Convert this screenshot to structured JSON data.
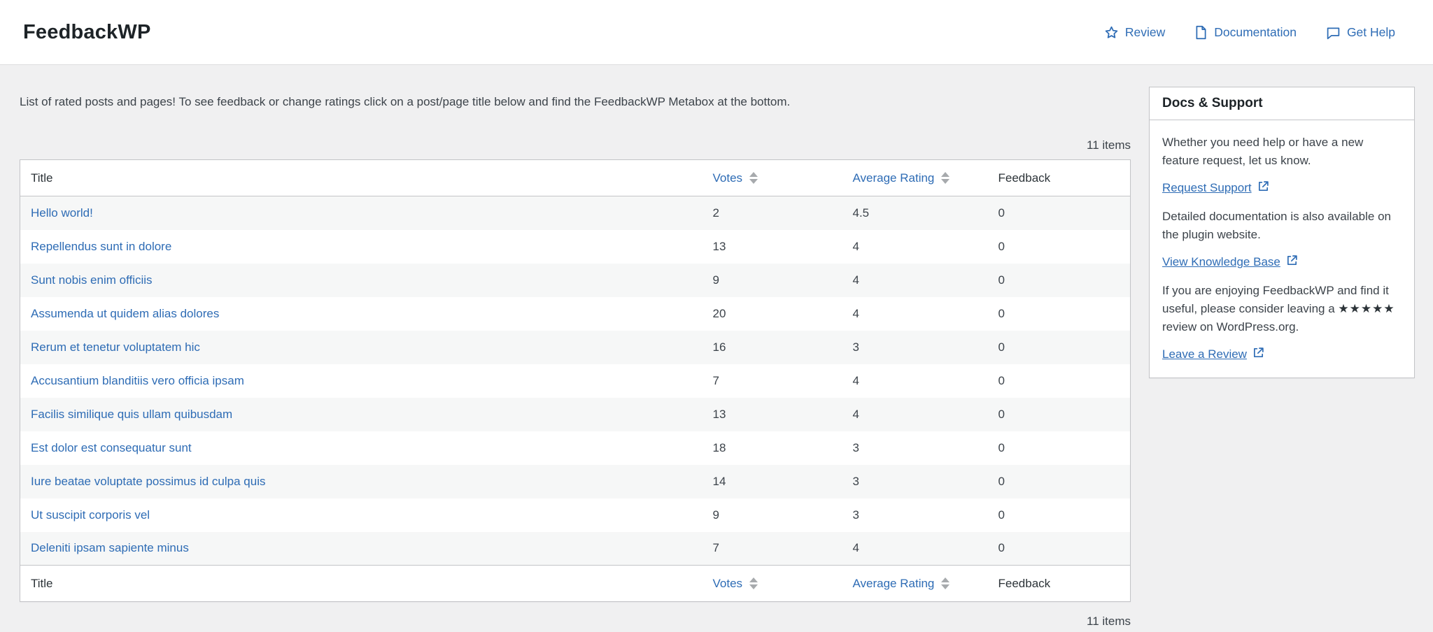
{
  "topbar": {
    "title": "FeedbackWP",
    "links": [
      {
        "label": "Review",
        "icon": "star-icon"
      },
      {
        "label": "Documentation",
        "icon": "document-icon"
      },
      {
        "label": "Get Help",
        "icon": "chat-icon"
      }
    ]
  },
  "main": {
    "intro": "List of rated posts and pages! To see feedback or change ratings click on a post/page title below and find the FeedbackWP Metabox at the bottom.",
    "items_count_top": "11 items",
    "items_count_bottom": "11 items"
  },
  "table": {
    "columns": {
      "title": "Title",
      "votes": "Votes",
      "rating": "Average Rating",
      "feedback": "Feedback"
    },
    "sortable_columns": [
      "Votes",
      "Average Rating"
    ],
    "rows": [
      {
        "title": "Hello world!",
        "votes": "2",
        "rating": "4.5",
        "feedback": "0"
      },
      {
        "title": "Repellendus sunt in dolore",
        "votes": "13",
        "rating": "4",
        "feedback": "0"
      },
      {
        "title": "Sunt nobis enim officiis",
        "votes": "9",
        "rating": "4",
        "feedback": "0"
      },
      {
        "title": "Assumenda ut quidem alias dolores",
        "votes": "20",
        "rating": "4",
        "feedback": "0"
      },
      {
        "title": "Rerum et tenetur voluptatem hic",
        "votes": "16",
        "rating": "3",
        "feedback": "0"
      },
      {
        "title": "Accusantium blanditiis vero officia ipsam",
        "votes": "7",
        "rating": "4",
        "feedback": "0"
      },
      {
        "title": "Facilis similique quis ullam quibusdam",
        "votes": "13",
        "rating": "4",
        "feedback": "0"
      },
      {
        "title": "Est dolor est consequatur sunt",
        "votes": "18",
        "rating": "3",
        "feedback": "0"
      },
      {
        "title": "Iure beatae voluptate possimus id culpa quis",
        "votes": "14",
        "rating": "3",
        "feedback": "0"
      },
      {
        "title": "Ut suscipit corporis vel",
        "votes": "9",
        "rating": "3",
        "feedback": "0"
      },
      {
        "title": "Deleniti ipsam sapiente minus",
        "votes": "7",
        "rating": "4",
        "feedback": "0"
      }
    ]
  },
  "sidebar": {
    "title": "Docs & Support",
    "support_text": "Whether you need help or have a new feature request, let us know.",
    "support_link": "Request Support",
    "docs_text": "Detailed documentation is also available on the plugin website.",
    "docs_link": "View Knowledge Base",
    "review_text_before": "If you are enjoying FeedbackWP and find it useful, please consider leaving a",
    "review_stars": "★★★★★",
    "review_text_after": "review on WordPress.org.",
    "review_link": "Leave a Review"
  },
  "colors": {
    "link_blue": "#2e6cb5",
    "page_background": "#f0f0f1",
    "panel_background": "#ffffff",
    "table_border": "#c3c4c7",
    "row_stripe": "#f6f7f7",
    "heading_text": "#1d2327",
    "body_text": "#3c434a",
    "sort_arrow_gray": "#a7aaad"
  }
}
